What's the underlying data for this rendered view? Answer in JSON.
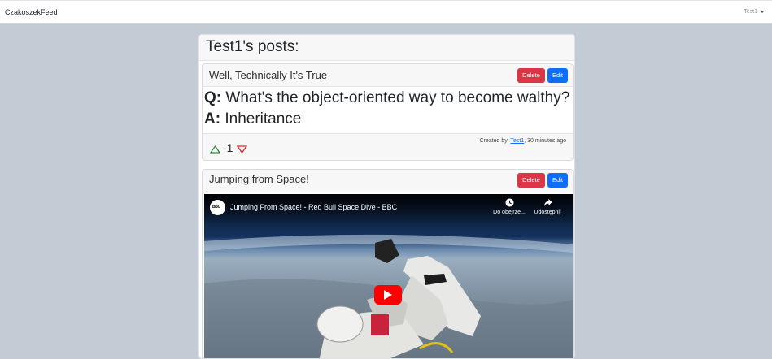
{
  "navbar": {
    "brand": "CzakoszekFeed",
    "user": "Test1"
  },
  "page": {
    "title": "Test1's posts:"
  },
  "posts": [
    {
      "title": "Well, Technically It's True",
      "delete_label": "Delete",
      "edit_label": "Edit",
      "question_prefix": "Q:",
      "question": "What's the object-oriented way to become walthy?",
      "answer_prefix": "A:",
      "answer": "Inheritance",
      "score": "-1",
      "created_by_label": "Created by:",
      "author": "Test1",
      "time": ", 30 minutes ago"
    },
    {
      "title": "Jumping from Space!",
      "delete_label": "Delete",
      "edit_label": "Edit",
      "video": {
        "channel_badge": "BBC",
        "title": "Jumping From Space! - Red Bull Space Dive - BBC",
        "watch_later": "Do obejrze...",
        "share": "Udostępnij"
      }
    }
  ],
  "colors": {
    "delete": "#dc3545",
    "edit": "#0d6efd",
    "upvote": "#2e8b3d",
    "downvote": "#d42a2a",
    "youtube_play": "#ff0000"
  },
  "icons": {
    "upvote": "triangle-up-outline",
    "downvote": "triangle-down-outline",
    "watch_later": "clock-icon",
    "share": "share-arrow-icon",
    "play": "youtube-play-icon"
  }
}
